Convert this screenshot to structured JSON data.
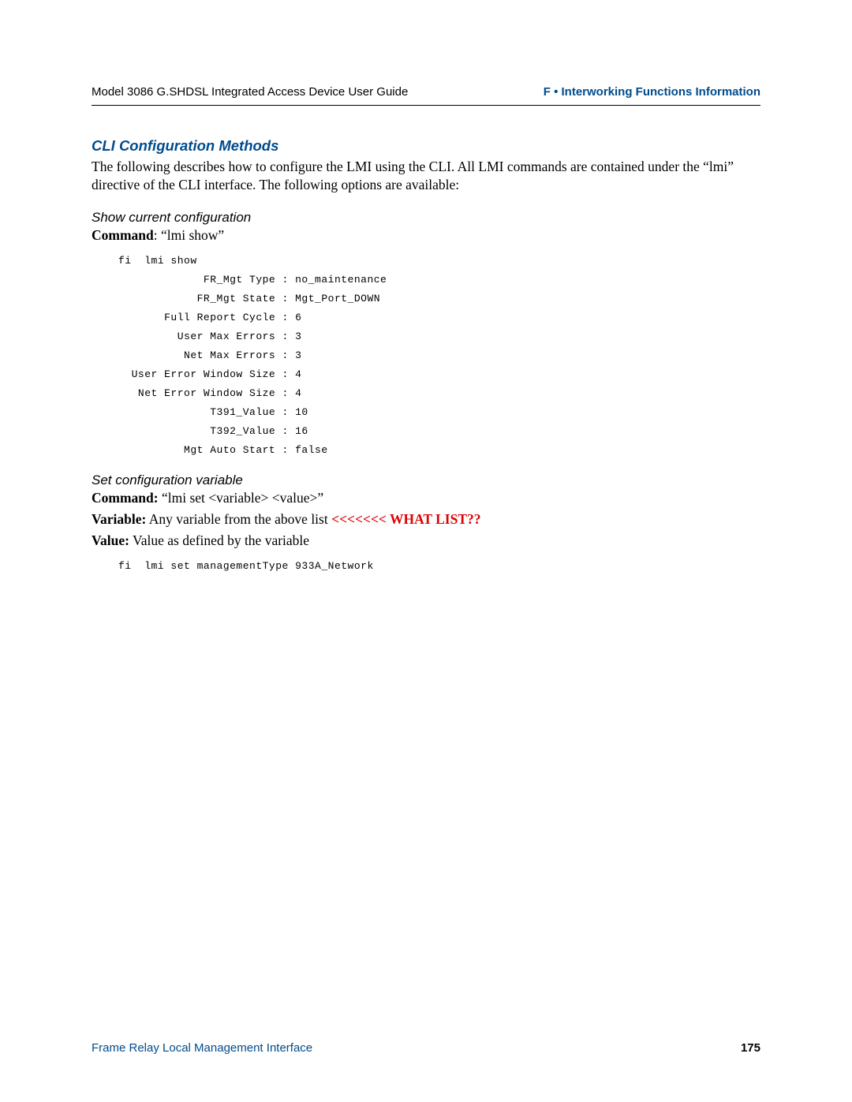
{
  "header": {
    "left": "Model 3086 G.SHDSL Integrated Access Device User Guide",
    "right": "F • Interworking Functions Information"
  },
  "section": {
    "title": "CLI Configuration Methods",
    "intro": "The following describes how to configure the LMI using the CLI. All LMI commands are contained under the “lmi” directive of the CLI interface. The following options are available:"
  },
  "sub1": {
    "title": "Show current configuration",
    "command_label": "Command",
    "command_value": ": “lmi show”",
    "code": "fi  lmi show\n             FR_Mgt Type : no_maintenance\n            FR_Mgt State : Mgt_Port_DOWN\n       Full Report Cycle : 6\n         User Max Errors : 3\n          Net Max Errors : 3\n  User Error Window Size : 4\n   Net Error Window Size : 4\n              T391_Value : 10\n              T392_Value : 16\n          Mgt Auto Start : false"
  },
  "sub2": {
    "title": "Set configuration variable",
    "command_label": "Command:",
    "command_value": " “lmi set <variable> <value>”",
    "variable_label": "Variable:",
    "variable_value": " Any variable from the above list ",
    "variable_note": "<<<<<<< WHAT LIST??",
    "value_label": "Value:",
    "value_value": " Value as defined by the variable",
    "code": "fi  lmi set managementType 933A_Network"
  },
  "footer": {
    "left": "Frame Relay Local Management Interface",
    "page": "175"
  }
}
